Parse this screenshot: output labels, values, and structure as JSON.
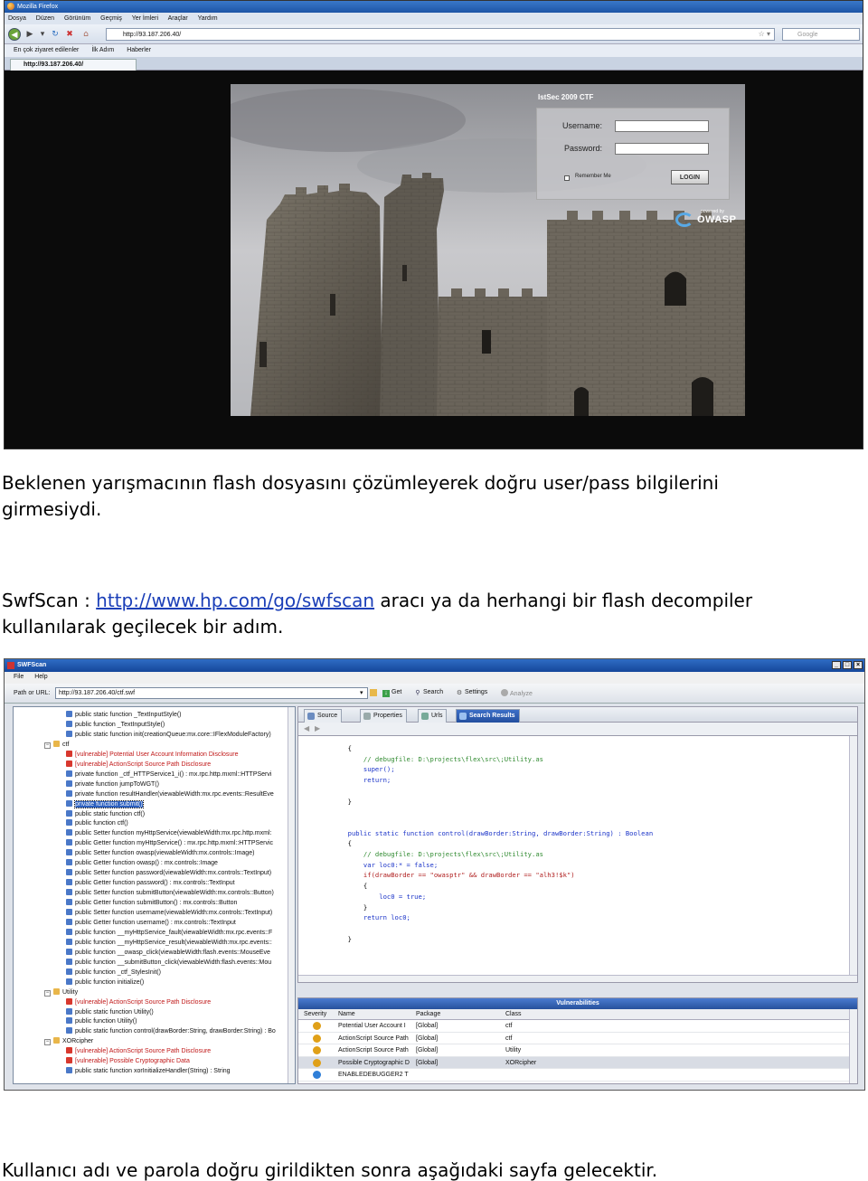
{
  "firefox_window": {
    "title": "Mozilla Firefox",
    "menu": [
      "Dosya",
      "Düzen",
      "Görünüm",
      "Geçmiş",
      "Yer İmleri",
      "Araçlar",
      "Yardım"
    ],
    "url": "http://93.187.206.40/",
    "search_placeholder": "Google",
    "bookmarks": [
      "En çok ziyaret edilenler",
      "İlk Adım",
      "Haberler"
    ],
    "tab_label": "http://93.187.206.40/",
    "page": {
      "ctf_title": "IstSec 2009 CTF",
      "username_label": "Username:",
      "password_label": "Password:",
      "remember_label": "Remember Me",
      "login_button": "LOGIN",
      "powered_by": "powered by",
      "owasp": "OWASP"
    }
  },
  "text": {
    "para1_line1": "Beklenen yarışmacının flash dosyasını çözümleyerek doğru user/pass bilgilerini",
    "para1_line2": "girmesiydi.",
    "para2_prefix": "SwfScan : ",
    "para2_link": "http://www.hp.com/go/swfscan",
    "para2_suffix": " aracı ya da herhangi bir flash decompiler",
    "para2_line2": "kullanılarak geçilecek bir adım.",
    "para3": "Kullanıcı adı ve parola doğru girildikten sonra aşağıdaki sayfa gelecektir."
  },
  "swfscan": {
    "title": "SWFScan",
    "menu": [
      "File",
      "Help"
    ],
    "path_label": "Path or URL:",
    "path_value": "http://93.187.206.40/ctf.swf",
    "toolbar": [
      "Get",
      "Search",
      "Settings",
      "Analyze"
    ],
    "tabs": [
      "Source",
      "Properties",
      "Urls",
      "Search Results"
    ],
    "tree": [
      {
        "text": "public static function _TextInputStyle()",
        "kind": "fn",
        "indent": 1
      },
      {
        "text": "public function _TextInputStyle()",
        "kind": "fn",
        "indent": 1
      },
      {
        "text": "public static function init(creationQueue:mx.core::IFlexModuleFactory)",
        "kind": "fn",
        "indent": 1
      },
      {
        "text": "ctf",
        "kind": "pkg",
        "indent": 0
      },
      {
        "text": "[vulnerable] Potential User Account Information Disclosure",
        "kind": "vuln",
        "indent": 1
      },
      {
        "text": "[vulnerable] ActionScript Source Path Disclosure",
        "kind": "vuln",
        "indent": 1
      },
      {
        "text": "private function _ctf_HTTPService1_i() : mx.rpc.http.mxml::HTTPServi",
        "kind": "fn",
        "indent": 1
      },
      {
        "text": "private function jumpToWGT()",
        "kind": "fn",
        "indent": 1
      },
      {
        "text": "private function resultHandler(viewableWidth:mx.rpc.events::ResultEve",
        "kind": "fn",
        "indent": 1
      },
      {
        "text": "private function submit()",
        "kind": "sel",
        "indent": 1
      },
      {
        "text": "public static function ctf()",
        "kind": "fn",
        "indent": 1
      },
      {
        "text": "public function ctf()",
        "kind": "fn",
        "indent": 1
      },
      {
        "text": "public Setter function myHttpService(viewableWidth:mx.rpc.http.mxml:",
        "kind": "fn",
        "indent": 1
      },
      {
        "text": "public Getter function myHttpService() : mx.rpc.http.mxml::HTTPServic",
        "kind": "fn",
        "indent": 1
      },
      {
        "text": "public Setter function owasp(viewableWidth:mx.controls::Image)",
        "kind": "fn",
        "indent": 1
      },
      {
        "text": "public Getter function owasp() : mx.controls::Image",
        "kind": "fn",
        "indent": 1
      },
      {
        "text": "public Setter function password(viewableWidth:mx.controls::TextInput)",
        "kind": "fn",
        "indent": 1
      },
      {
        "text": "public Getter function password() : mx.controls::TextInput",
        "kind": "fn",
        "indent": 1
      },
      {
        "text": "public Setter function submitButton(viewableWidth:mx.controls::Button)",
        "kind": "fn",
        "indent": 1
      },
      {
        "text": "public Getter function submitButton() : mx.controls::Button",
        "kind": "fn",
        "indent": 1
      },
      {
        "text": "public Setter function username(viewableWidth:mx.controls::TextInput)",
        "kind": "fn",
        "indent": 1
      },
      {
        "text": "public Getter function username() : mx.controls::TextInput",
        "kind": "fn",
        "indent": 1
      },
      {
        "text": "public function __myHttpService_fault(viewableWidth:mx.rpc.events::F",
        "kind": "fn",
        "indent": 1
      },
      {
        "text": "public function __myHttpService_result(viewableWidth:mx.rpc.events::",
        "kind": "fn",
        "indent": 1
      },
      {
        "text": "public function __owasp_click(viewableWidth:flash.events::MouseEve",
        "kind": "fn",
        "indent": 1
      },
      {
        "text": "public function __submitButton_click(viewableWidth:flash.events::Mou",
        "kind": "fn",
        "indent": 1
      },
      {
        "text": "public function _ctf_StylesInit()",
        "kind": "fn",
        "indent": 1
      },
      {
        "text": "public function initialize()",
        "kind": "fn",
        "indent": 1
      },
      {
        "text": "Utility",
        "kind": "pkg",
        "indent": 0
      },
      {
        "text": "[vulnerable] ActionScript Source Path Disclosure",
        "kind": "vuln",
        "indent": 1
      },
      {
        "text": "public static function Utility()",
        "kind": "fn",
        "indent": 1
      },
      {
        "text": "public function Utility()",
        "kind": "fn",
        "indent": 1
      },
      {
        "text": "public static function control(drawBorder:String, drawBorder:String) : Bo",
        "kind": "fn",
        "indent": 1
      },
      {
        "text": "XORcipher",
        "kind": "pkg",
        "indent": 0
      },
      {
        "text": "[vulnerable] ActionScript Source Path Disclosure",
        "kind": "vuln",
        "indent": 1
      },
      {
        "text": "[vulnerable] Possible Cryptographic Data",
        "kind": "vuln",
        "indent": 1
      },
      {
        "text": "public static function xorInitializeHandler(String) : String",
        "kind": "fn",
        "indent": 1
      }
    ],
    "code_lines": [
      {
        "t": "        {",
        "c": ""
      },
      {
        "t": "            // debugfile: D:\\projects\\flex\\src\\;Utility.as",
        "c": "cm"
      },
      {
        "t": "            super();",
        "c": "kw"
      },
      {
        "t": "            return;",
        "c": "kw"
      },
      {
        "t": "",
        "c": ""
      },
      {
        "t": "        }",
        "c": ""
      },
      {
        "t": "",
        "c": ""
      },
      {
        "t": "",
        "c": ""
      },
      {
        "t": "        public static function control(drawBorder:String, drawBorder:String) : Boolean",
        "c": "kw"
      },
      {
        "t": "        {",
        "c": ""
      },
      {
        "t": "            // debugfile: D:\\projects\\flex\\src\\;Utility.as",
        "c": "cm"
      },
      {
        "t": "            var loc0:* = false;",
        "c": "kw"
      },
      {
        "t": "            if(drawBorder == \"owasptr\" && drawBorder == \"alh3!$k\")",
        "c": "st"
      },
      {
        "t": "            {",
        "c": ""
      },
      {
        "t": "                loc0 = true;",
        "c": "kw"
      },
      {
        "t": "            }",
        "c": ""
      },
      {
        "t": "            return loc0;",
        "c": "kw"
      },
      {
        "t": "",
        "c": ""
      },
      {
        "t": "        }",
        "c": ""
      },
      {
        "t": "",
        "c": ""
      },
      {
        "t": "",
        "c": ""
      },
      {
        "t": "",
        "c": ""
      },
      {
        "t": "    }",
        "c": ""
      }
    ],
    "vulnerabilities": {
      "title": "Vulnerabilities",
      "columns": [
        "Severity",
        "Name",
        "Package",
        "Class"
      ],
      "rows": [
        {
          "sev": "#e0a018",
          "name": "Potential User Account I",
          "pkg": "[Global]",
          "cls": "ctf"
        },
        {
          "sev": "#e0a018",
          "name": "ActionScript Source Path",
          "pkg": "[Global]",
          "cls": "ctf"
        },
        {
          "sev": "#e0a018",
          "name": "ActionScript Source Path",
          "pkg": "[Global]",
          "cls": "Utility"
        },
        {
          "sev": "#e0a018",
          "name": "Possible Cryptographic D",
          "pkg": "[Global]",
          "cls": "XORcipher"
        },
        {
          "sev": "#2f7fd8",
          "name": "ENABLEDEBUGGER2 T",
          "pkg": "",
          "cls": ""
        }
      ]
    }
  }
}
